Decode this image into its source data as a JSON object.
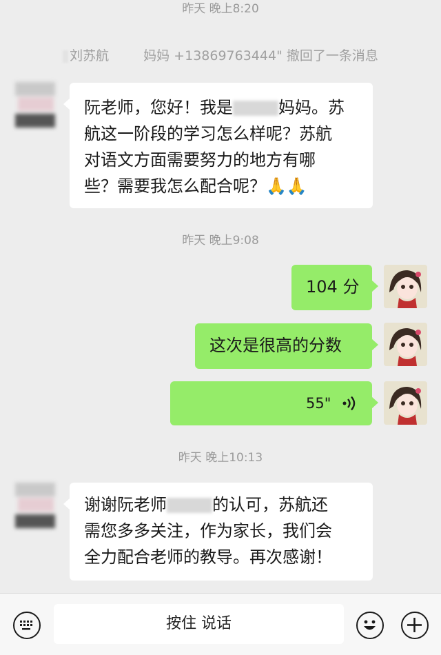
{
  "timestamps": [
    "昨天 晚上8:20",
    "昨天 晚上9:08",
    "昨天 晚上10:13"
  ],
  "system_message": {
    "sender": "刘苏航",
    "text": "妈妈 +13869763444\" 撤回了一条消息"
  },
  "messages": [
    {
      "side": "left",
      "line1_a": "阮老师，您好！我是",
      "line1_b": "妈妈。苏",
      "line2": "航这一阶段的学习怎么样呢？苏航",
      "line3": "对语文方面需要努力的地方有哪",
      "line4": "些？需要我怎么配合呢？",
      "emoji": "🙏🙏"
    },
    {
      "side": "right",
      "text": "104 分"
    },
    {
      "side": "right",
      "text": "这次是很高的分数"
    },
    {
      "side": "right",
      "type": "voice",
      "duration": "55\""
    },
    {
      "side": "left",
      "line1_a": "谢谢阮老师",
      "line1_b": "的认可，苏航还",
      "line2": "需您多多关注，作为家长，我们会",
      "line3": "全力配合老师的教导。再次感谢！"
    }
  ],
  "input_bar": {
    "keyboard_icon": "keyboard-icon",
    "talk_label": "按住 说话",
    "emoji_icon": "emoji-icon",
    "plus_icon": "plus-icon"
  },
  "colors": {
    "background": "#ededed",
    "bubble_left": "#ffffff",
    "bubble_right": "#95ec69"
  }
}
